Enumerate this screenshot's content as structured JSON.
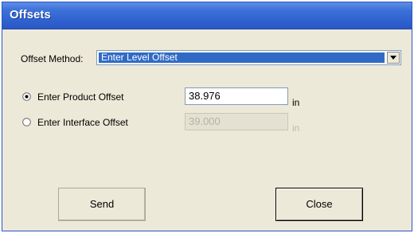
{
  "window": {
    "title": "Offsets"
  },
  "offset_method": {
    "label": "Offset Method:",
    "selected": "Enter Level Offset",
    "dropdown_icon": "chevron-down-icon"
  },
  "options": [
    {
      "label": "Enter Product Offset",
      "selected": true,
      "value": "38.976",
      "unit": "in",
      "enabled": true
    },
    {
      "label": "Enter Interface Offset",
      "selected": false,
      "value": "39.000",
      "unit": "in",
      "enabled": false
    }
  ],
  "buttons": {
    "send": "Send",
    "close": "Close"
  },
  "colors": {
    "titlebar": "#2f62cf",
    "selection": "#316ac5",
    "dialog_bg": "#ece9d8"
  }
}
